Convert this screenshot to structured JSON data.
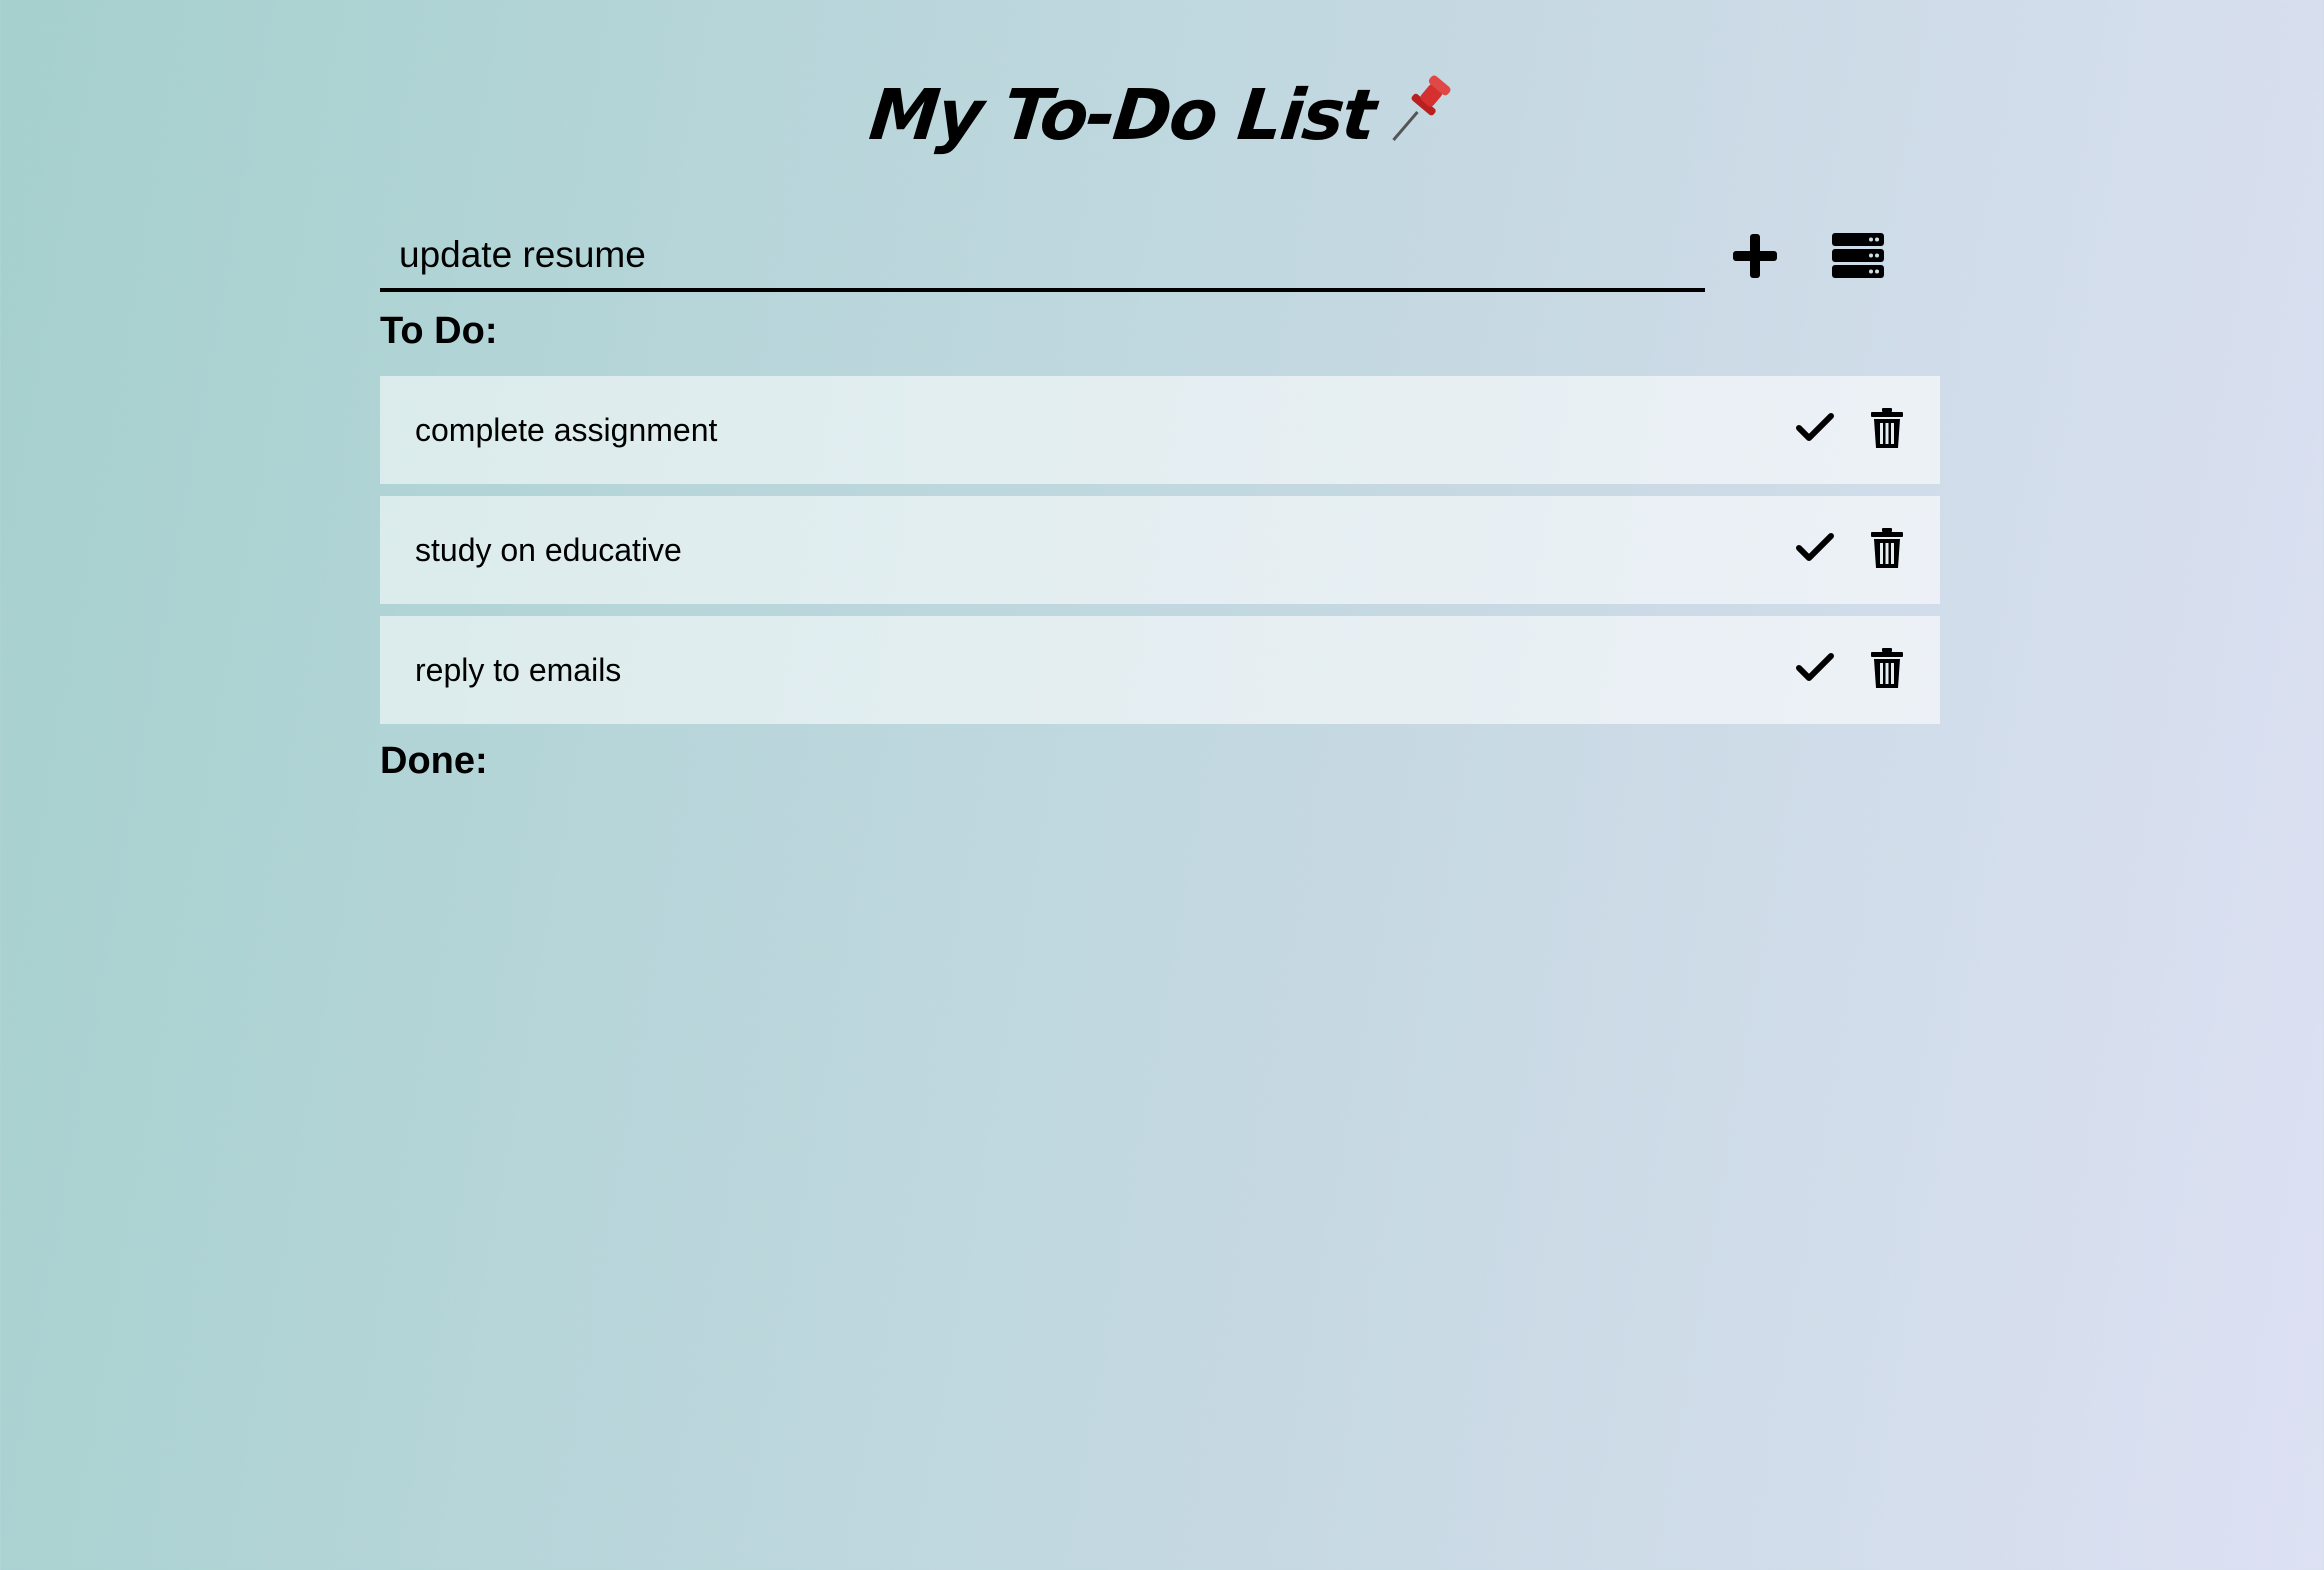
{
  "header": {
    "title": "My To-Do List",
    "title_emoji": "📌",
    "pin_icon": "pushpin-icon"
  },
  "input": {
    "value": "update resume",
    "add_icon": "plus-icon",
    "storage_icon": "database-icon"
  },
  "sections": {
    "todo_label": "To Do:",
    "done_label": "Done:"
  },
  "todo_items": [
    {
      "text": "complete assignment",
      "complete_icon": "check-icon",
      "delete_icon": "trash-icon"
    },
    {
      "text": "study on educative",
      "complete_icon": "check-icon",
      "delete_icon": "trash-icon"
    },
    {
      "text": "reply to emails",
      "complete_icon": "check-icon",
      "delete_icon": "trash-icon"
    }
  ],
  "done_items": [],
  "colors": {
    "background_start": "#a5d0cd",
    "background_end": "#dde1f3",
    "item_background": "#e2eef1",
    "text": "#000000",
    "pin_red": "#d62f2f"
  }
}
